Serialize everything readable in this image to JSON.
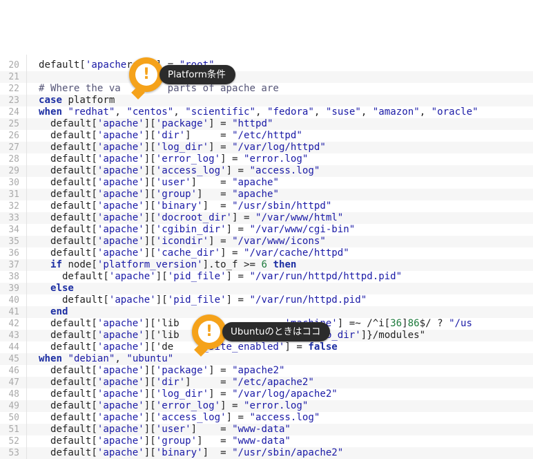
{
  "colors": {
    "keyword": "#1c2ea3",
    "string": "#1a1aa6",
    "number": "#1c7a3b",
    "callout_accent": "#f5a21a",
    "callout_label_bg": "#2b2b2b"
  },
  "lines": [
    {
      "n": "20",
      "segs": [
        [
          "t",
          "default["
        ],
        [
          "s",
          "'apache"
        ],
        [
          "t",
          ""
        ],
        [
          "t",
          ""
        ],
        [
          "t",
          "roup'] "
        ],
        [
          "t",
          "= "
        ],
        [
          "s",
          "\"root\""
        ]
      ]
    },
    {
      "n": "21",
      "segs": []
    },
    {
      "n": "22",
      "segs": [
        [
          "c",
          "# Where the va        parts of apache are"
        ]
      ]
    },
    {
      "n": "23",
      "segs": [
        [
          "k",
          "case"
        ],
        [
          "t",
          " platform"
        ]
      ]
    },
    {
      "n": "24",
      "segs": [
        [
          "k",
          "when"
        ],
        [
          "t",
          " "
        ],
        [
          "s",
          "\"redhat\""
        ],
        [
          "t",
          ", "
        ],
        [
          "s",
          "\"centos\""
        ],
        [
          "t",
          ", "
        ],
        [
          "s",
          "\"scientific\""
        ],
        [
          "t",
          ", "
        ],
        [
          "s",
          "\"fedora\""
        ],
        [
          "t",
          ", "
        ],
        [
          "s",
          "\"suse\""
        ],
        [
          "t",
          ", "
        ],
        [
          "s",
          "\"amazon\""
        ],
        [
          "t",
          ", "
        ],
        [
          "s",
          "\"oracle\""
        ]
      ]
    },
    {
      "n": "25",
      "segs": [
        [
          "t",
          "  default["
        ],
        [
          "s",
          "'apache'"
        ],
        [
          "t",
          "]["
        ],
        [
          "s",
          "'package'"
        ],
        [
          "t",
          "] = "
        ],
        [
          "s",
          "\"httpd\""
        ]
      ]
    },
    {
      "n": "26",
      "segs": [
        [
          "t",
          "  default["
        ],
        [
          "s",
          "'apache'"
        ],
        [
          "t",
          "]["
        ],
        [
          "s",
          "'dir'"
        ],
        [
          "t",
          "]     = "
        ],
        [
          "s",
          "\"/etc/httpd\""
        ]
      ]
    },
    {
      "n": "27",
      "segs": [
        [
          "t",
          "  default["
        ],
        [
          "s",
          "'apache'"
        ],
        [
          "t",
          "]["
        ],
        [
          "s",
          "'log_dir'"
        ],
        [
          "t",
          "] = "
        ],
        [
          "s",
          "\"/var/log/httpd\""
        ]
      ]
    },
    {
      "n": "28",
      "segs": [
        [
          "t",
          "  default["
        ],
        [
          "s",
          "'apache'"
        ],
        [
          "t",
          "]["
        ],
        [
          "s",
          "'error_log'"
        ],
        [
          "t",
          "] = "
        ],
        [
          "s",
          "\"error.log\""
        ]
      ]
    },
    {
      "n": "29",
      "segs": [
        [
          "t",
          "  default["
        ],
        [
          "s",
          "'apache'"
        ],
        [
          "t",
          "]["
        ],
        [
          "s",
          "'access_log'"
        ],
        [
          "t",
          "] = "
        ],
        [
          "s",
          "\"access.log\""
        ]
      ]
    },
    {
      "n": "30",
      "segs": [
        [
          "t",
          "  default["
        ],
        [
          "s",
          "'apache'"
        ],
        [
          "t",
          "]["
        ],
        [
          "s",
          "'user'"
        ],
        [
          "t",
          "]    = "
        ],
        [
          "s",
          "\"apache\""
        ]
      ]
    },
    {
      "n": "31",
      "segs": [
        [
          "t",
          "  default["
        ],
        [
          "s",
          "'apache'"
        ],
        [
          "t",
          "]["
        ],
        [
          "s",
          "'group'"
        ],
        [
          "t",
          "]   = "
        ],
        [
          "s",
          "\"apache\""
        ]
      ]
    },
    {
      "n": "32",
      "segs": [
        [
          "t",
          "  default["
        ],
        [
          "s",
          "'apache'"
        ],
        [
          "t",
          "]["
        ],
        [
          "s",
          "'binary'"
        ],
        [
          "t",
          "]  = "
        ],
        [
          "s",
          "\"/usr/sbin/httpd\""
        ]
      ]
    },
    {
      "n": "33",
      "segs": [
        [
          "t",
          "  default["
        ],
        [
          "s",
          "'apache'"
        ],
        [
          "t",
          "]["
        ],
        [
          "s",
          "'docroot_dir'"
        ],
        [
          "t",
          "] = "
        ],
        [
          "s",
          "\"/var/www/html\""
        ]
      ]
    },
    {
      "n": "34",
      "segs": [
        [
          "t",
          "  default["
        ],
        [
          "s",
          "'apache'"
        ],
        [
          "t",
          "]["
        ],
        [
          "s",
          "'cgibin_dir'"
        ],
        [
          "t",
          "] = "
        ],
        [
          "s",
          "\"/var/www/cgi-bin\""
        ]
      ]
    },
    {
      "n": "35",
      "segs": [
        [
          "t",
          "  default["
        ],
        [
          "s",
          "'apache'"
        ],
        [
          "t",
          "]["
        ],
        [
          "s",
          "'icondir'"
        ],
        [
          "t",
          "] = "
        ],
        [
          "s",
          "\"/var/www/icons\""
        ]
      ]
    },
    {
      "n": "36",
      "segs": [
        [
          "t",
          "  default["
        ],
        [
          "s",
          "'apache'"
        ],
        [
          "t",
          "]["
        ],
        [
          "s",
          "'cache_dir'"
        ],
        [
          "t",
          "] = "
        ],
        [
          "s",
          "\"/var/cache/httpd\""
        ]
      ]
    },
    {
      "n": "37",
      "segs": [
        [
          "k",
          "  if"
        ],
        [
          "t",
          " node["
        ],
        [
          "s",
          "'platform_version'"
        ],
        [
          "t",
          "].to_f >= "
        ],
        [
          "n",
          "6"
        ],
        [
          "t",
          " "
        ],
        [
          "k",
          "then"
        ]
      ]
    },
    {
      "n": "38",
      "segs": [
        [
          "t",
          "    default["
        ],
        [
          "s",
          "'apache'"
        ],
        [
          "t",
          "]["
        ],
        [
          "s",
          "'pid_file'"
        ],
        [
          "t",
          "] = "
        ],
        [
          "s",
          "\"/var/run/httpd/httpd.pid\""
        ]
      ]
    },
    {
      "n": "39",
      "segs": [
        [
          "k",
          "  else"
        ]
      ]
    },
    {
      "n": "40",
      "segs": [
        [
          "t",
          "    default["
        ],
        [
          "s",
          "'apache'"
        ],
        [
          "t",
          "]["
        ],
        [
          "s",
          "'pid_file'"
        ],
        [
          "t",
          "] = "
        ],
        [
          "s",
          "\"/var/run/httpd.pid\""
        ]
      ]
    },
    {
      "n": "41",
      "segs": [
        [
          "k",
          "  end"
        ]
      ]
    },
    {
      "n": "42",
      "segs": [
        [
          "t",
          "  default["
        ],
        [
          "s",
          "'apache'"
        ],
        [
          "t",
          "]['lib                  "
        ],
        [
          "s",
          "'machine'"
        ],
        [
          "t",
          "] =~ /^i["
        ],
        [
          "n",
          "36"
        ],
        [
          "t",
          "]"
        ],
        [
          "n",
          "86"
        ],
        [
          "t",
          "$/ ? "
        ],
        [
          "s",
          "\"/us"
        ]
      ]
    },
    {
      "n": "43",
      "segs": [
        [
          "t",
          "  default["
        ],
        [
          "s",
          "'apache'"
        ],
        [
          "t",
          "]['lib                 "
        ],
        [
          "s",
          "he'"
        ],
        [
          "t",
          "]["
        ],
        [
          "s",
          "'lib_dir'"
        ],
        [
          "t",
          "]}/modules\""
        ]
      ]
    },
    {
      "n": "44",
      "segs": [
        [
          "t",
          "  default["
        ],
        [
          "s",
          "'apache'"
        ],
        [
          "t",
          "]['de"
        ],
        [
          "s",
          "     _site_enabled'"
        ],
        [
          "t",
          "] = "
        ],
        [
          "k",
          "false"
        ]
      ]
    },
    {
      "n": "45",
      "segs": [
        [
          "k",
          "when"
        ],
        [
          "t",
          " "
        ],
        [
          "s",
          "\"debian\""
        ],
        [
          "t",
          ", "
        ],
        [
          "s",
          "\"ubuntu\""
        ]
      ]
    },
    {
      "n": "46",
      "segs": [
        [
          "t",
          "  default["
        ],
        [
          "s",
          "'apache'"
        ],
        [
          "t",
          "]["
        ],
        [
          "s",
          "'package'"
        ],
        [
          "t",
          "] = "
        ],
        [
          "s",
          "\"apache2\""
        ]
      ]
    },
    {
      "n": "47",
      "segs": [
        [
          "t",
          "  default["
        ],
        [
          "s",
          "'apache'"
        ],
        [
          "t",
          "]["
        ],
        [
          "s",
          "'dir'"
        ],
        [
          "t",
          "]     = "
        ],
        [
          "s",
          "\"/etc/apache2\""
        ]
      ]
    },
    {
      "n": "48",
      "segs": [
        [
          "t",
          "  default["
        ],
        [
          "s",
          "'apache'"
        ],
        [
          "t",
          "]["
        ],
        [
          "s",
          "'log_dir'"
        ],
        [
          "t",
          "] = "
        ],
        [
          "s",
          "\"/var/log/apache2\""
        ]
      ]
    },
    {
      "n": "49",
      "segs": [
        [
          "t",
          "  default["
        ],
        [
          "s",
          "'apache'"
        ],
        [
          "t",
          "]["
        ],
        [
          "s",
          "'error_log'"
        ],
        [
          "t",
          "] = "
        ],
        [
          "s",
          "\"error.log\""
        ]
      ]
    },
    {
      "n": "50",
      "segs": [
        [
          "t",
          "  default["
        ],
        [
          "s",
          "'apache'"
        ],
        [
          "t",
          "]["
        ],
        [
          "s",
          "'access_log'"
        ],
        [
          "t",
          "] = "
        ],
        [
          "s",
          "\"access.log\""
        ]
      ]
    },
    {
      "n": "51",
      "segs": [
        [
          "t",
          "  default["
        ],
        [
          "s",
          "'apache'"
        ],
        [
          "t",
          "]["
        ],
        [
          "s",
          "'user'"
        ],
        [
          "t",
          "]    = "
        ],
        [
          "s",
          "\"www-data\""
        ]
      ]
    },
    {
      "n": "52",
      "segs": [
        [
          "t",
          "  default["
        ],
        [
          "s",
          "'apache'"
        ],
        [
          "t",
          "]["
        ],
        [
          "s",
          "'group'"
        ],
        [
          "t",
          "]   = "
        ],
        [
          "s",
          "\"www-data\""
        ]
      ]
    },
    {
      "n": "53",
      "segs": [
        [
          "t",
          "  default["
        ],
        [
          "s",
          "'apache'"
        ],
        [
          "t",
          "]["
        ],
        [
          "s",
          "'binary'"
        ],
        [
          "t",
          "]  = "
        ],
        [
          "s",
          "\"/usr/sbin/apache2\""
        ]
      ]
    }
  ],
  "callouts": [
    {
      "icon": "!",
      "label": "Platform条件"
    },
    {
      "icon": "!",
      "label": "Ubuntuのときはココ"
    }
  ]
}
